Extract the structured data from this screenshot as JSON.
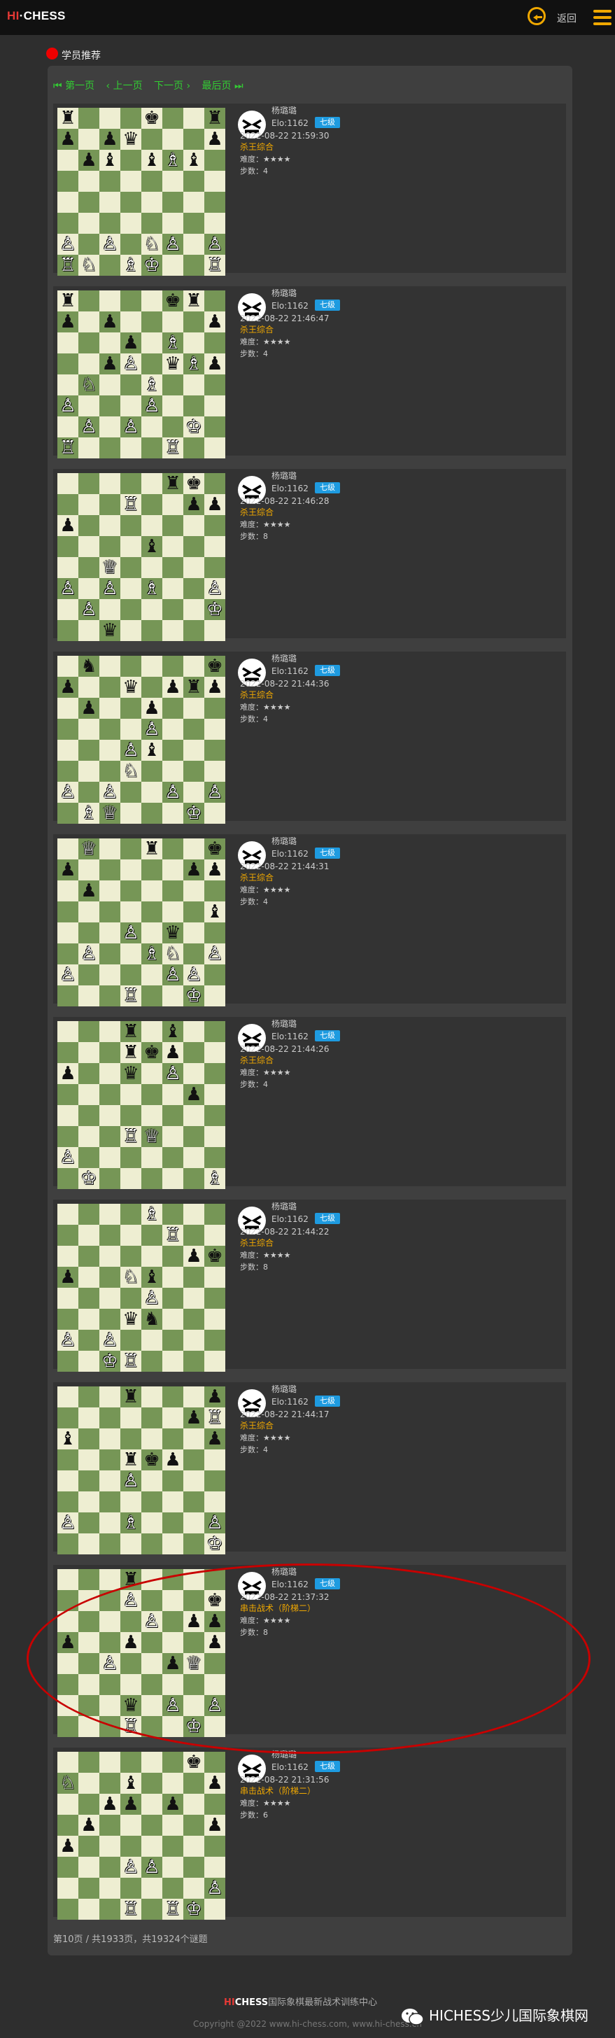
{
  "header": {
    "logo_hi": "HI",
    "logo_sep": "·",
    "logo_chess": "CHESS",
    "back_label": "返回",
    "back_icon": "back-arrow-icon",
    "menu_icon": "hamburger-menu-icon"
  },
  "section": {
    "title": "学员推荐"
  },
  "pager": {
    "first": "第一页",
    "prev": "上一页",
    "next": "下一页",
    "last": "最后页"
  },
  "colors": {
    "accent": "#f0a800",
    "badge": "#1e9be0",
    "pager_link": "#33cc33",
    "highlight_ellipse": "#c80000"
  },
  "puzzles": [
    {
      "name": "杨璐璐",
      "elo": "Elo:1162",
      "level": "七级",
      "datetime": "2022-08-22 21:59:30",
      "category": "杀王综合",
      "difficulty": "难度：★★★★",
      "steps": "步数：4",
      "board": [
        "r...k..r",
        "p.pq...p",
        ".pb.bBb.",
        "........",
        "........",
        "........",
        "P.P.NP.P",
        "RN.BK..R"
      ]
    },
    {
      "name": "杨璐璐",
      "elo": "Elo:1162",
      "level": "七级",
      "datetime": "2022-08-22 21:46:47",
      "category": "杀王综合",
      "difficulty": "难度：★★★★",
      "steps": "步数：4",
      "board": [
        "r....kr.",
        "p.p....p",
        "...p.B..",
        "..pP.qBp",
        ".N..B...",
        "P...P...",
        ".P.P..K.",
        "R....R.."
      ]
    },
    {
      "name": "杨璐璐",
      "elo": "Elo:1162",
      "level": "七级",
      "datetime": "2022-08-22 21:46:28",
      "category": "杀王综合",
      "difficulty": "难度：★★★★",
      "steps": "步数：8",
      "board": [
        ".....rk.",
        "...R..pp",
        "p.......",
        "....b...",
        "..Q.....",
        "P.P.B..P",
        ".P.....K",
        "..q....."
      ]
    },
    {
      "name": "杨璐璐",
      "elo": "Elo:1162",
      "level": "七级",
      "datetime": "2022-08-22 21:44:36",
      "category": "杀王综合",
      "difficulty": "难度：★★★★",
      "steps": "步数：4",
      "board": [
        ".n.....k",
        "p..q.prp",
        ".p..p...",
        "....P...",
        "...Pb...",
        "...N....",
        "P.P..P.P",
        ".BQ...K."
      ]
    },
    {
      "name": "杨璐璐",
      "elo": "Elo:1162",
      "level": "七级",
      "datetime": "2022-08-22 21:44:31",
      "category": "杀王综合",
      "difficulty": "难度：★★★★",
      "steps": "步数：4",
      "board": [
        ".Q..r..k",
        "p.....pp",
        ".p......",
        ".......b",
        "...P.q..",
        ".P..BN.P",
        "P....PP.",
        "...R..K."
      ]
    },
    {
      "name": "杨璐璐",
      "elo": "Elo:1162",
      "level": "七级",
      "datetime": "2022-08-22 21:44:26",
      "category": "杀王综合",
      "difficulty": "难度：★★★★",
      "steps": "步数：4",
      "board": [
        "...r.b..",
        "...rkp..",
        "p..q.P..",
        "......p.",
        "........",
        "...RQ...",
        "P.......",
        ".K.....B"
      ]
    },
    {
      "name": "杨璐璐",
      "elo": "Elo:1162",
      "level": "七级",
      "datetime": "2022-08-22 21:44:22",
      "category": "杀王综合",
      "difficulty": "难度：★★★★",
      "steps": "步数：8",
      "board": [
        "....B...",
        ".....R..",
        "......pk",
        "p..Nb...",
        "....P...",
        "...qn...",
        "P.P.....",
        "..KR...."
      ]
    },
    {
      "name": "杨璐璐",
      "elo": "Elo:1162",
      "level": "七级",
      "datetime": "2022-08-22 21:44:17",
      "category": "杀王综合",
      "difficulty": "难度：★★★★",
      "steps": "步数：4",
      "board": [
        "...r...p",
        "......pR",
        "b......p",
        "...rkp..",
        "...P....",
        "........",
        "P..B...P",
        ".......K"
      ]
    },
    {
      "name": "杨璐璐",
      "elo": "Elo:1162",
      "level": "七级",
      "datetime": "2022-08-22 21:37:32",
      "category": "串击战术（阶梯二）",
      "difficulty": "难度：★★★★",
      "steps": "步数：8",
      "board": [
        "...r....",
        "...P...k",
        "....P.pp",
        "p..p...p",
        "..P..pQ.",
        "........",
        "...q.P.P",
        "...R..K."
      ]
    },
    {
      "name": "杨璐璐",
      "elo": "Elo:1162",
      "level": "七级",
      "datetime": "2022-08-22 21:31:56",
      "category": "串击战术（阶梯二）",
      "difficulty": "难度：★★★★",
      "steps": "步数：6",
      "board": [
        "......k.",
        "N..b...p",
        "..pp.p..",
        ".p.....p",
        "p.......",
        "...PP...",
        ".......P",
        "...R.RK."
      ]
    }
  ],
  "pagination_status": "第10页 / 共1933页，共19324个谜题",
  "footer": {
    "hi": "HI",
    "chess": "CHESS",
    "center_text": "国际象棋最新战术训练中心",
    "copyright": "Copyright @2022 www.hi-chess.com, www.hi-chess.cn",
    "wechat": "HICHESS少儿国际象棋网"
  }
}
